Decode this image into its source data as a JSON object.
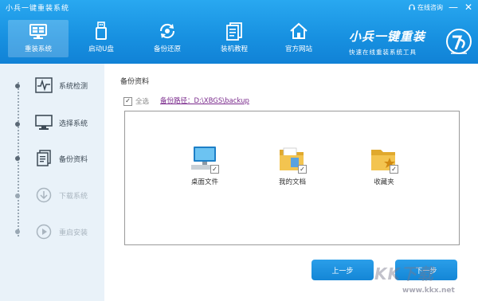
{
  "app": {
    "title": "小兵一键重装系统",
    "online_help": "在线咨询",
    "minimize": "—",
    "close": "✕"
  },
  "nav": {
    "tabs": [
      {
        "label": "重装系统",
        "icon": "monitor-icon",
        "active": true
      },
      {
        "label": "启动U盘",
        "icon": "usb-icon",
        "active": false
      },
      {
        "label": "备份还原",
        "icon": "backup-restore-icon",
        "active": false
      },
      {
        "label": "装机教程",
        "icon": "tutorial-icon",
        "active": false
      },
      {
        "label": "官方网站",
        "icon": "home-icon",
        "active": false
      }
    ]
  },
  "brand": {
    "name": "小兵一键重装",
    "slogan": "快速在线重装系统工具"
  },
  "sidebar": {
    "steps": [
      {
        "label": "系统检测",
        "icon": "pulse-icon",
        "enabled": true
      },
      {
        "label": "选择系统",
        "icon": "monitor-icon",
        "enabled": true
      },
      {
        "label": "备份资料",
        "icon": "document-icon",
        "enabled": true
      },
      {
        "label": "下载系统",
        "icon": "download-icon",
        "enabled": false
      },
      {
        "label": "重启安装",
        "icon": "restart-icon",
        "enabled": false
      }
    ]
  },
  "main": {
    "section_title": "备份资料",
    "select_all_label": "全选",
    "backup_path": "备份路径：D:\\XBGS\\backup",
    "items": [
      {
        "label": "桌面文件",
        "icon": "desktop-icon",
        "checked": true
      },
      {
        "label": "我的文档",
        "icon": "documents-folder-icon",
        "checked": true
      },
      {
        "label": "收藏夹",
        "icon": "favorites-folder-icon",
        "checked": true
      }
    ],
    "prev_button": "上一步",
    "next_button": "下一步"
  },
  "watermark": {
    "text": "KK下载",
    "url": "www.kkx.net"
  },
  "colors": {
    "header_blue": "#1790e0",
    "sidebar_bg": "#e9f2f9",
    "button_blue": "#1486d6",
    "path_link": "#7a2a8c"
  }
}
